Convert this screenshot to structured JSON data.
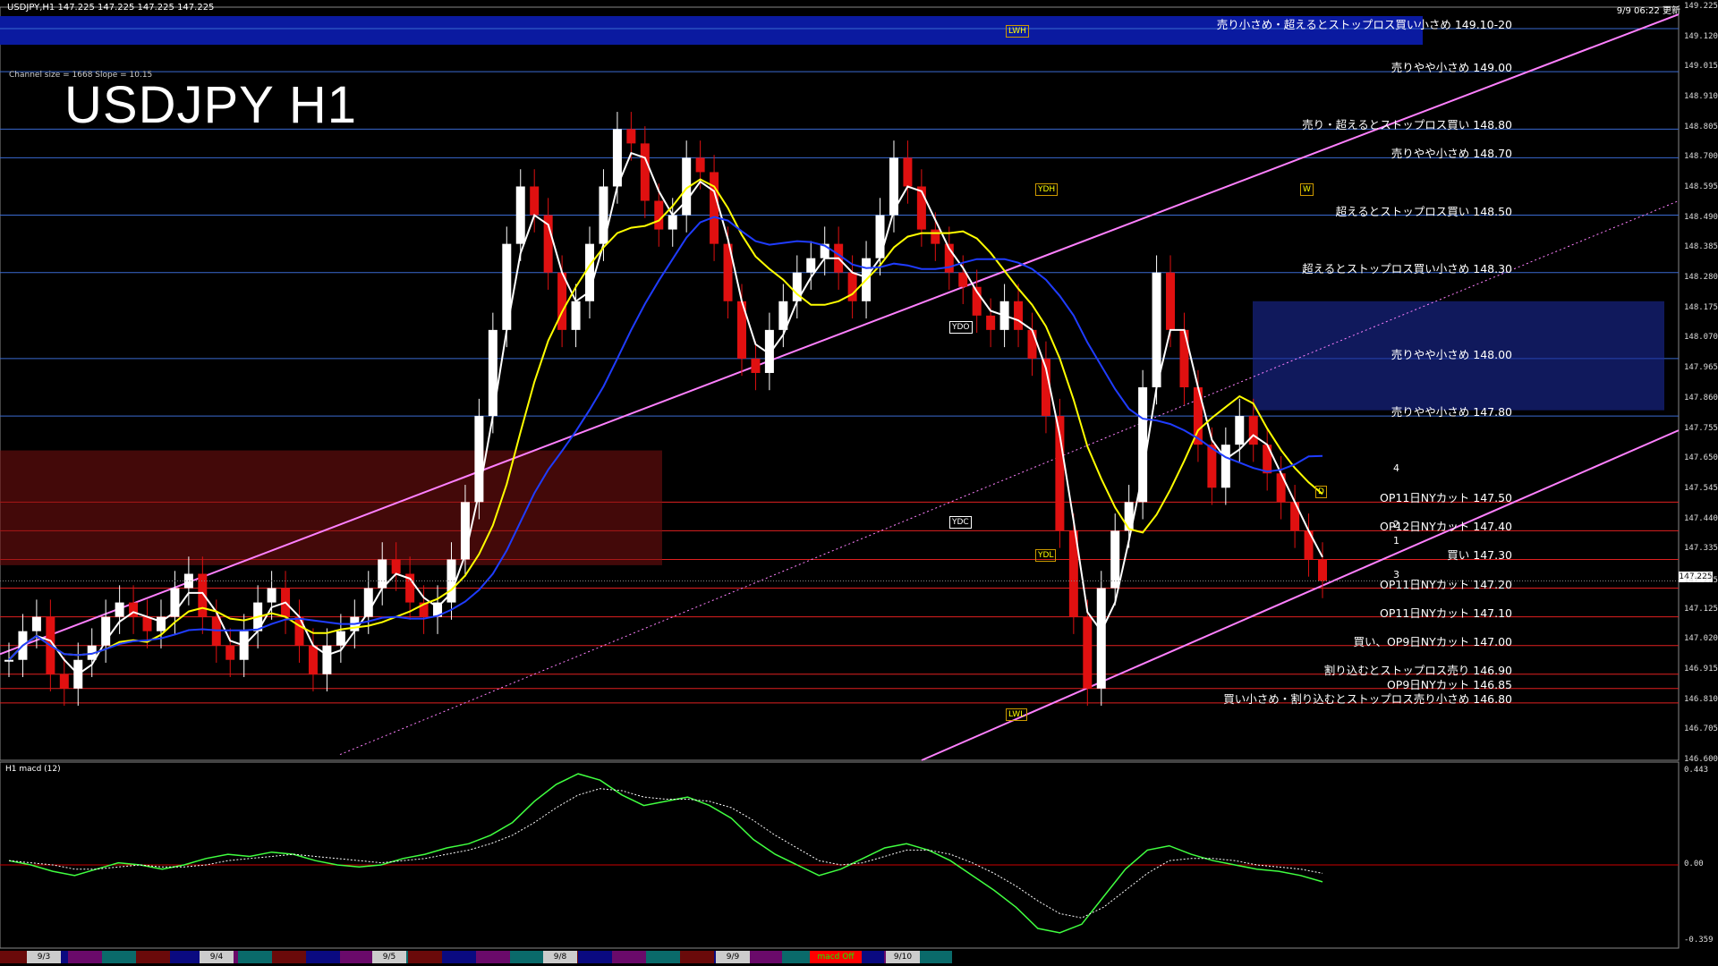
{
  "header": {
    "symbol_info": "USDJPY,H1  147.225 147.225 147.225 147.225",
    "updated": "9/9 06:22 更新"
  },
  "title": "USDJPY H1",
  "channel_info": "Channel size = 1668 Slope = 10.15",
  "subpanel_title": "H1  macd (12)",
  "current_price": "147.225",
  "colors": {
    "background": "#000000",
    "bull": "#ffffff",
    "bear": "#e01010",
    "channel": "#ff80ff",
    "band_top": "#0a1aa0"
  },
  "chart_data": {
    "type": "line",
    "title": "USDJPY H1",
    "y_axis": {
      "min": 146.6,
      "max": 149.225,
      "ticks": [
        "149.225",
        "149.120",
        "149.015",
        "148.910",
        "148.805",
        "148.700",
        "148.595",
        "148.490",
        "148.385",
        "148.280",
        "148.175",
        "148.070",
        "147.965",
        "147.860",
        "147.755",
        "147.650",
        "147.545",
        "147.440",
        "147.335",
        "147.225",
        "147.125",
        "147.020",
        "146.915",
        "146.810",
        "146.705",
        "146.600"
      ]
    },
    "date_labels": [
      "9/3",
      "9/4",
      "9/5",
      "9/8",
      "9/9",
      "9/10"
    ],
    "levels": [
      {
        "text": "売り小さめ・超えるとストップロス買い小さめ 149.10-20",
        "price": 149.15
      },
      {
        "text": "売りやや小さめ 149.00",
        "price": 149.0
      },
      {
        "text": "売り・超えるとストップロス買い 148.80",
        "price": 148.8
      },
      {
        "text": "売りやや小さめ 148.70",
        "price": 148.7
      },
      {
        "text": "超えるとストップロス買い 148.50",
        "price": 148.5
      },
      {
        "text": "超えるとストップロス買い小さめ 148.30",
        "price": 148.3
      },
      {
        "text": "売りやや小さめ 148.00",
        "price": 148.0
      },
      {
        "text": "売りやや小さめ 147.80",
        "price": 147.8
      },
      {
        "text": "OP11日NYカット 147.50",
        "price": 147.5
      },
      {
        "text": "OP12日NYカット 147.40",
        "price": 147.4
      },
      {
        "text": "買い 147.30",
        "price": 147.3
      },
      {
        "text": "OP11日NYカット 147.20",
        "price": 147.2
      },
      {
        "text": "OP11日NYカット 147.10",
        "price": 147.1
      },
      {
        "text": "買い、OP9日NYカット 147.00",
        "price": 147.0
      },
      {
        "text": "割り込むとストップロス売り 146.90",
        "price": 146.9
      },
      {
        "text": "OP9日NYカット 146.85",
        "price": 146.85
      },
      {
        "text": "買い小さめ・割り込むとストップロス売り小さめ 146.80",
        "price": 146.8
      }
    ],
    "close_series": [
      146.95,
      147.05,
      147.1,
      146.9,
      146.85,
      146.95,
      147.0,
      147.1,
      147.15,
      147.1,
      147.05,
      147.1,
      147.2,
      147.25,
      147.1,
      147.0,
      146.95,
      147.05,
      147.15,
      147.2,
      147.1,
      147.0,
      146.9,
      147.0,
      147.05,
      147.1,
      147.2,
      147.3,
      147.25,
      147.15,
      147.1,
      147.15,
      147.3,
      147.5,
      147.8,
      148.1,
      148.4,
      148.6,
      148.5,
      148.3,
      148.1,
      148.2,
      148.4,
      148.6,
      148.8,
      148.75,
      148.55,
      148.45,
      148.5,
      148.7,
      148.65,
      148.4,
      148.2,
      148.0,
      147.95,
      148.1,
      148.2,
      148.3,
      148.35,
      148.4,
      148.3,
      148.2,
      148.35,
      148.5,
      148.7,
      148.6,
      148.45,
      148.4,
      148.3,
      148.25,
      148.15,
      148.1,
      148.2,
      148.1,
      148.0,
      147.8,
      147.4,
      147.1,
      146.85,
      147.2,
      147.4,
      147.5,
      147.9,
      148.3,
      148.1,
      147.9,
      147.7,
      147.55,
      147.7,
      147.8,
      147.7,
      147.6,
      147.5,
      147.4,
      147.3,
      147.225
    ],
    "macd": {
      "range": [
        -0.359,
        0.443
      ],
      "ticks": [
        "0.443",
        "0.00",
        "-0.359"
      ],
      "main": [
        0.02,
        0.0,
        -0.03,
        -0.05,
        -0.02,
        0.01,
        0.0,
        -0.02,
        0.0,
        0.03,
        0.05,
        0.04,
        0.06,
        0.05,
        0.02,
        0.0,
        -0.01,
        0.0,
        0.03,
        0.05,
        0.08,
        0.1,
        0.14,
        0.2,
        0.3,
        0.38,
        0.43,
        0.4,
        0.33,
        0.28,
        0.3,
        0.32,
        0.28,
        0.22,
        0.12,
        0.05,
        0.0,
        -0.05,
        -0.02,
        0.03,
        0.08,
        0.1,
        0.07,
        0.02,
        -0.05,
        -0.12,
        -0.2,
        -0.3,
        -0.32,
        -0.28,
        -0.15,
        -0.02,
        0.07,
        0.09,
        0.05,
        0.02,
        0.0,
        -0.02,
        -0.03,
        -0.05,
        -0.08
      ],
      "signal": [
        0.02,
        0.01,
        0.0,
        -0.02,
        -0.02,
        -0.01,
        0.0,
        -0.01,
        -0.01,
        0.0,
        0.02,
        0.03,
        0.04,
        0.05,
        0.04,
        0.03,
        0.02,
        0.01,
        0.02,
        0.03,
        0.05,
        0.07,
        0.1,
        0.14,
        0.2,
        0.27,
        0.33,
        0.36,
        0.35,
        0.32,
        0.31,
        0.31,
        0.3,
        0.27,
        0.21,
        0.14,
        0.08,
        0.02,
        0.0,
        0.01,
        0.04,
        0.07,
        0.07,
        0.05,
        0.01,
        -0.04,
        -0.1,
        -0.17,
        -0.23,
        -0.25,
        -0.2,
        -0.12,
        -0.04,
        0.02,
        0.03,
        0.03,
        0.02,
        0.0,
        -0.01,
        -0.02,
        -0.04
      ]
    }
  },
  "tags": {
    "lwh": "LWH",
    "lwl": "LWL",
    "ydh": "YDH",
    "ydl": "YDL",
    "ydo": "YDO",
    "ydc": "YDC",
    "w": "W",
    "d": "D"
  },
  "wave_marks": [
    "4",
    "2",
    "1",
    "3"
  ],
  "bottom_tab": "macd Off"
}
